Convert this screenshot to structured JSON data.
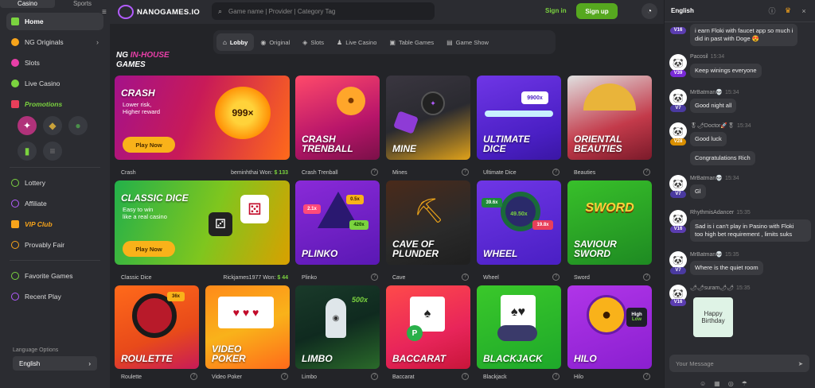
{
  "sidebar": {
    "tabs": [
      "Casino",
      "Sports"
    ],
    "items": [
      {
        "label": "Home",
        "icon": "home-icon"
      },
      {
        "label": "NG Originals",
        "icon": "ng-originals-icon"
      },
      {
        "label": "Slots",
        "icon": "slots-icon"
      },
      {
        "label": "Live Casino",
        "icon": "live-casino-icon"
      },
      {
        "label": "Promotions",
        "icon": "promotions-icon"
      }
    ],
    "items2": [
      {
        "label": "Lottery",
        "icon": "lottery-icon"
      },
      {
        "label": "Affiliate",
        "icon": "affiliate-icon"
      },
      {
        "label": "VIP Club",
        "icon": "vip-icon"
      },
      {
        "label": "Provably Fair",
        "icon": "fair-icon"
      }
    ],
    "items3": [
      {
        "label": "Favorite Games",
        "icon": "favorite-icon"
      },
      {
        "label": "Recent Play",
        "icon": "recent-icon"
      }
    ],
    "language_label": "Language Options",
    "language_value": "English"
  },
  "header": {
    "logo": "NANOGAMES.IO",
    "search_placeholder": "Game name | Provider | Category Tag",
    "signin": "Sign in",
    "signup": "Sign up"
  },
  "tabs": [
    "Lobby",
    "Original",
    "Slots",
    "Live Casino",
    "Table Games",
    "Game Show"
  ],
  "section": {
    "line1_a": "NG",
    "line1_b": "IN-HOUSE",
    "line2": "GAMES"
  },
  "games": {
    "crash": {
      "title": "CRASH",
      "sub1": "Lower risk,",
      "sub2": "Higher reward",
      "play": "Play Now",
      "caption": "Crash",
      "winner": "beminhthai",
      "won_label": "Won:",
      "won": "$ 133",
      "multiplier": "999×"
    },
    "classic": {
      "title": "CLASSIC DICE",
      "sub1": "Easy to win",
      "sub2": "like a real casino",
      "play": "Play Now",
      "caption": "Classic Dice",
      "winner": "Rickjames1977",
      "won_label": "Won:",
      "won": "$ 44"
    },
    "crash_trenball": {
      "title1": "CRASH",
      "title2": "TRENBALL",
      "caption": "Crash Trenball"
    },
    "mine": {
      "title": "MINE",
      "caption": "Mines"
    },
    "ultimate": {
      "title1": "ULTIMATE",
      "title2": "DICE",
      "caption": "Ultimate Dice",
      "badge": "9900x"
    },
    "oriental": {
      "title1": "ORIENTAL",
      "title2": "BEAUTIES",
      "caption": "Beauties"
    },
    "plinko": {
      "title": "PLINKO",
      "caption": "Plinko",
      "b1": "2.1x",
      "b2": "0.5x",
      "b3": "420x"
    },
    "cave": {
      "title1": "CAVE OF",
      "title2": "PLUNDER",
      "caption": "Cave"
    },
    "wheel": {
      "title": "WHEEL",
      "caption": "Wheel",
      "b1": "39.6x",
      "b2": "49.50x",
      "b3": "19.8x"
    },
    "saviour": {
      "title1": "SAVIOUR",
      "title2": "SWORD",
      "caption": "Sword",
      "logo": "SWORD"
    },
    "roulette": {
      "title": "ROULETTE",
      "caption": "Roulette",
      "badge": "36x"
    },
    "video_poker": {
      "title1": "VIDEO",
      "title2": "POKER",
      "caption": "Video Poker"
    },
    "limbo": {
      "title": "LIMBO",
      "caption": "Limbo",
      "badge": "500x"
    },
    "baccarat": {
      "title": "BACCARAT",
      "caption": "Baccarat"
    },
    "blackjack": {
      "title": "BLACKJACK",
      "caption": "Blackjack"
    },
    "hilo": {
      "title": "HILO",
      "caption": "Hilo",
      "high": "High",
      "low": "Low"
    }
  },
  "chat": {
    "language": "English",
    "input_placeholder": "Your Message",
    "messages": [
      {
        "level": "V16",
        "text1": "i earn Floki with faucet app so much i",
        "text2": "did in past with Doge 😍"
      },
      {
        "user": "Pacosil",
        "time": "15:34",
        "level": "V39",
        "text": "Keep winings everyone"
      },
      {
        "user": "MrBatman💀",
        "time": "15:34",
        "level": "V7",
        "text": "Good night all"
      },
      {
        "user": "🎖🌶Doctor🚀🎖",
        "time": "15:34",
        "level": "V28",
        "text": "Good luck",
        "text_b": "Congratulations Rich"
      },
      {
        "user": "MrBatman💀",
        "time": "15:34",
        "level": "V7",
        "text": "Gl"
      },
      {
        "user": "RhythmisAdancer",
        "time": "15:35",
        "level": "V16",
        "text1": "Sad is i can't play in Pasino with Floki",
        "text2": "too high bet requirement , limits suks"
      },
      {
        "user": "MrBatman💀",
        "time": "15:35",
        "level": "V7",
        "text": "Where is the quiet room"
      },
      {
        "user": "🌶🌶suram🌶🌶",
        "time": "15:35",
        "level": "V16",
        "sticker": "Happy Birthday"
      }
    ]
  }
}
